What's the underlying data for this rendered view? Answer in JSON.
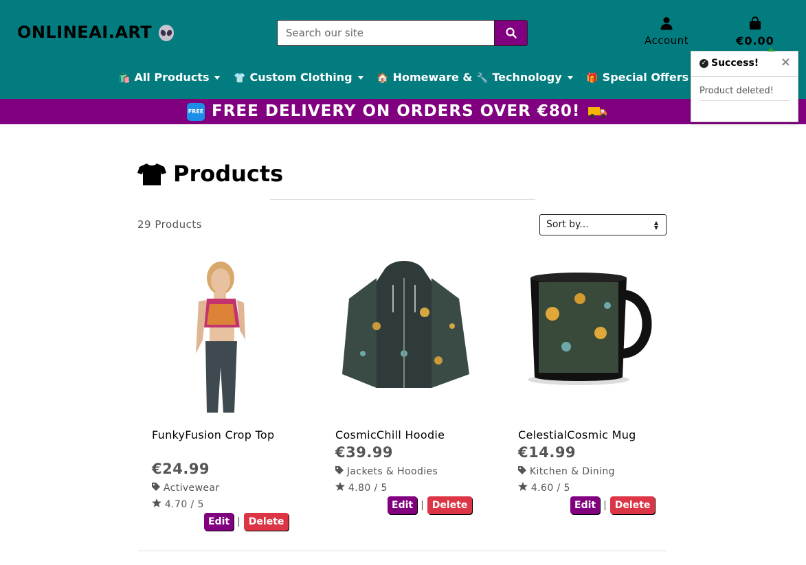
{
  "brand": {
    "logo_text": "ONLINEAI.ART"
  },
  "search": {
    "placeholder": "Search our site"
  },
  "account": {
    "label": "Account"
  },
  "bag": {
    "total": "€0.00"
  },
  "nav": {
    "items": [
      {
        "emoji": "🛍️",
        "label": "All Products"
      },
      {
        "emoji": "👕",
        "label": "Custom Clothing"
      },
      {
        "emoji": "🏠",
        "label": "Homeware &"
      },
      {
        "emoji": "🔧",
        "label": "Technology"
      },
      {
        "emoji": "🎁",
        "label": "Special Offers"
      }
    ]
  },
  "banner": {
    "badge": "FREE",
    "text": "FREE DELIVERY ON ORDERS OVER €80!"
  },
  "toast": {
    "title": "Success!",
    "message": "Product deleted!"
  },
  "page": {
    "title": "Products",
    "count": "29 Products",
    "sort_placeholder": "Sort by..."
  },
  "products": [
    {
      "name": "FunkyFusion Crop Top",
      "price": "€24.99",
      "category": "Activewear",
      "rating": "4.70 / 5",
      "edit": "Edit",
      "separator": "|",
      "delete": "Delete"
    },
    {
      "name": "CosmicChill Hoodie",
      "price": "€39.99",
      "category": "Jackets & Hoodies",
      "rating": "4.80 / 5",
      "edit": "Edit",
      "separator": "|",
      "delete": "Delete"
    },
    {
      "name": "CelestialCosmic Mug",
      "price": "€14.99",
      "category": "Kitchen & Dining",
      "rating": "4.60 / 5",
      "edit": "Edit",
      "separator": "|",
      "delete": "Delete"
    }
  ],
  "colors": {
    "header": "#037c7f",
    "accent": "#800080",
    "danger": "#dc3545"
  }
}
